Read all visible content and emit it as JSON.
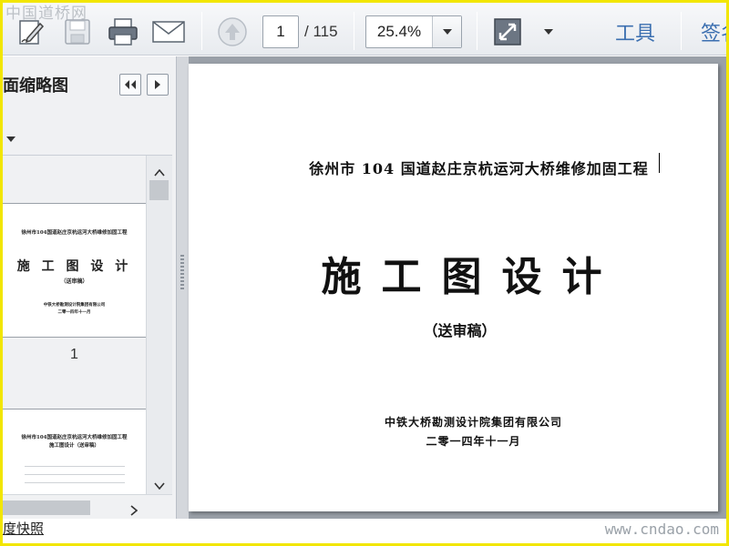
{
  "toolbar": {
    "icons": [
      "edit-sign-icon",
      "save-icon",
      "print-icon",
      "email-icon",
      "previous-page-icon",
      "fit-window-icon",
      "menu-dropdown-icon"
    ],
    "page_number": "1",
    "page_total": "/ 115",
    "zoom": "25.4%",
    "tools_label": "工具",
    "sign_label": "签名"
  },
  "watermark_top": "中国道桥网",
  "sidebar": {
    "title": "面缩略图",
    "thumbnails": [
      {
        "project": "徐州市104国道赵庄京杭运河大桥维修加固工程",
        "title": "施 工 图 设 计",
        "subtitle": "（送审稿）",
        "org": "中铁大桥勘测设计院集团有限公司",
        "date": "二零一四年十一月",
        "number": "1"
      },
      {
        "project": "徐州市104国道赵庄京杭运河大桥维修加固工程",
        "title": "施工图设计（送审稿）"
      }
    ]
  },
  "document": {
    "project": "徐州市 104 国道赵庄京杭运河大桥维修加固工程",
    "title": "施工图设计",
    "subtitle": "（送审稿）",
    "org": "中铁大桥勘测设计院集团有限公司",
    "date": "二零一四年十一月"
  },
  "footer": {
    "snapshot": "度快照",
    "site": "www.cndao.com"
  },
  "colors": {
    "frame": "#f2e600",
    "link_blue": "#3b6fb0",
    "doc_background": "#9aa0a8"
  }
}
